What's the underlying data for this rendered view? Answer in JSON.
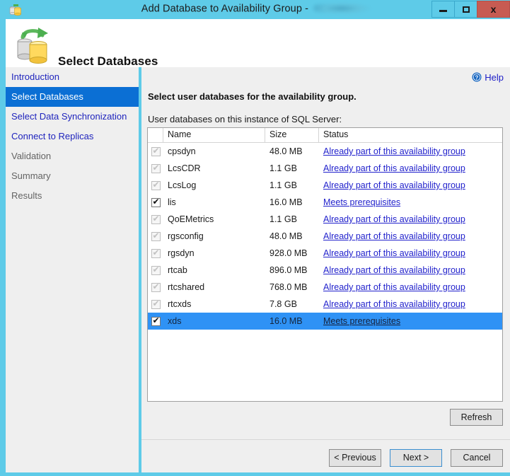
{
  "window": {
    "title_prefix": "Add Database to Availability Group - ",
    "title_redacted": "",
    "icon": "database-group-icon",
    "controls": {
      "minimize": "–",
      "maximize": "□",
      "close": "x"
    },
    "accent_color": "#5ecbe8",
    "close_color": "#c75b52"
  },
  "header": {
    "title": "Select Databases",
    "icon": "database-sync-icon"
  },
  "sidebar": {
    "items": [
      {
        "label": "Introduction",
        "state": "link"
      },
      {
        "label": "Select Databases",
        "state": "active"
      },
      {
        "label": "Select Data Synchronization",
        "state": "link"
      },
      {
        "label": "Connect to Replicas",
        "state": "link"
      },
      {
        "label": "Validation",
        "state": "disabled"
      },
      {
        "label": "Summary",
        "state": "disabled"
      },
      {
        "label": "Results",
        "state": "disabled"
      }
    ],
    "active_color": "#0b6fd4",
    "link_color": "#1f24bd"
  },
  "content": {
    "help_label": "Help",
    "help_icon": "help-circle-icon",
    "instruction": "Select user databases for the availability group.",
    "sublabel": "User databases on this instance of SQL Server:",
    "columns": [
      "",
      "Name",
      "Size",
      "Status"
    ],
    "rows": [
      {
        "checked": true,
        "enabled": false,
        "name": "cpsdyn",
        "size": "48.0 MB",
        "status": "Already part of this availability group"
      },
      {
        "checked": true,
        "enabled": false,
        "name": "LcsCDR",
        "size": "1.1 GB",
        "status": "Already part of this availability group"
      },
      {
        "checked": true,
        "enabled": false,
        "name": "LcsLog",
        "size": "1.1 GB",
        "status": "Already part of this availability group"
      },
      {
        "checked": true,
        "enabled": true,
        "name": "lis",
        "size": "16.0 MB",
        "status": "Meets prerequisites"
      },
      {
        "checked": true,
        "enabled": false,
        "name": "QoEMetrics",
        "size": "1.1 GB",
        "status": "Already part of this availability group"
      },
      {
        "checked": true,
        "enabled": false,
        "name": "rgsconfig",
        "size": "48.0 MB",
        "status": "Already part of this availability group"
      },
      {
        "checked": true,
        "enabled": false,
        "name": "rgsdyn",
        "size": "928.0 MB",
        "status": "Already part of this availability group"
      },
      {
        "checked": true,
        "enabled": false,
        "name": "rtcab",
        "size": "896.0 MB",
        "status": "Already part of this availability group"
      },
      {
        "checked": true,
        "enabled": false,
        "name": "rtcshared",
        "size": "768.0 MB",
        "status": "Already part of this availability group"
      },
      {
        "checked": true,
        "enabled": false,
        "name": "rtcxds",
        "size": "7.8 GB",
        "status": "Already part of this availability group"
      },
      {
        "checked": true,
        "enabled": true,
        "name": "xds",
        "size": "16.0 MB",
        "status": "Meets prerequisites",
        "selected": true
      }
    ],
    "refresh_label": "Refresh",
    "selection_color": "#2f92f5"
  },
  "footer": {
    "previous_label": "< Previous",
    "next_label": "Next >",
    "cancel_label": "Cancel"
  }
}
